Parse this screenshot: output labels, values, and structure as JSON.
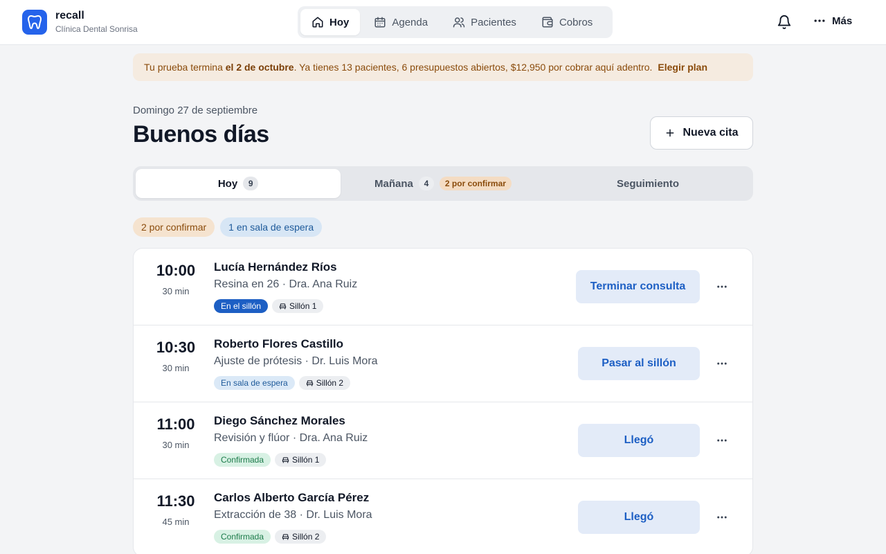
{
  "brand": {
    "name": "recall",
    "subtitle": "Clínica Dental Sonrisa",
    "logo_icon": "tooth-icon"
  },
  "nav": [
    {
      "label": "Hoy",
      "icon": "home-icon",
      "active": true
    },
    {
      "label": "Agenda",
      "icon": "calendar-icon",
      "active": false
    },
    {
      "label": "Pacientes",
      "icon": "users-icon",
      "active": false
    },
    {
      "label": "Cobros",
      "icon": "wallet-icon",
      "active": false
    }
  ],
  "header": {
    "more_label": "Más"
  },
  "banner": {
    "prefix": "Tu prueba termina ",
    "date": "el 2 de octubre",
    "suffix": ". Ya tienes 13 pacientes, 6 presupuestos abiertos, $12,950 por cobrar aquí adentro.",
    "link": "Elegir plan"
  },
  "date_label": "Domingo 27 de septiembre",
  "greeting": "Buenos días",
  "new_appointment_label": "Nueva cita",
  "tabs": {
    "today": {
      "label": "Hoy",
      "count": "9"
    },
    "tomorrow": {
      "label": "Mañana",
      "count": "4",
      "badge": "2 por confirmar"
    },
    "followup": {
      "label": "Seguimiento"
    }
  },
  "chips": {
    "pending": "2 por confirmar",
    "waiting": "1 en sala de espera"
  },
  "appointments": [
    {
      "time": "10:00",
      "duration": "30 min",
      "patient": "Lucía Hernández Ríos",
      "detail": "Resina en 26 · Dra. Ana Ruiz",
      "status": "En el sillón",
      "status_kind": "inchair",
      "seat": "Sillón 1",
      "action": "Terminar consulta"
    },
    {
      "time": "10:30",
      "duration": "30 min",
      "patient": "Roberto Flores Castillo",
      "detail": "Ajuste de prótesis · Dr. Luis Mora",
      "status": "En sala de espera",
      "status_kind": "waiting",
      "seat": "Sillón 2",
      "action": "Pasar al sillón"
    },
    {
      "time": "11:00",
      "duration": "30 min",
      "patient": "Diego Sánchez Morales",
      "detail": "Revisión y flúor · Dra. Ana Ruiz",
      "status": "Confirmada",
      "status_kind": "confirmed",
      "seat": "Sillón 1",
      "action": "Llegó"
    },
    {
      "time": "11:30",
      "duration": "45 min",
      "patient": "Carlos Alberto García Pérez",
      "detail": "Extracción de 38 · Dr. Luis Mora",
      "status": "Confirmada",
      "status_kind": "confirmed",
      "seat": "Sillón 2",
      "action": "Llegó"
    }
  ],
  "colors": {
    "accent": "#2563eb",
    "action_text": "#1d5fc4",
    "warning_bg": "#f5ebe0"
  }
}
